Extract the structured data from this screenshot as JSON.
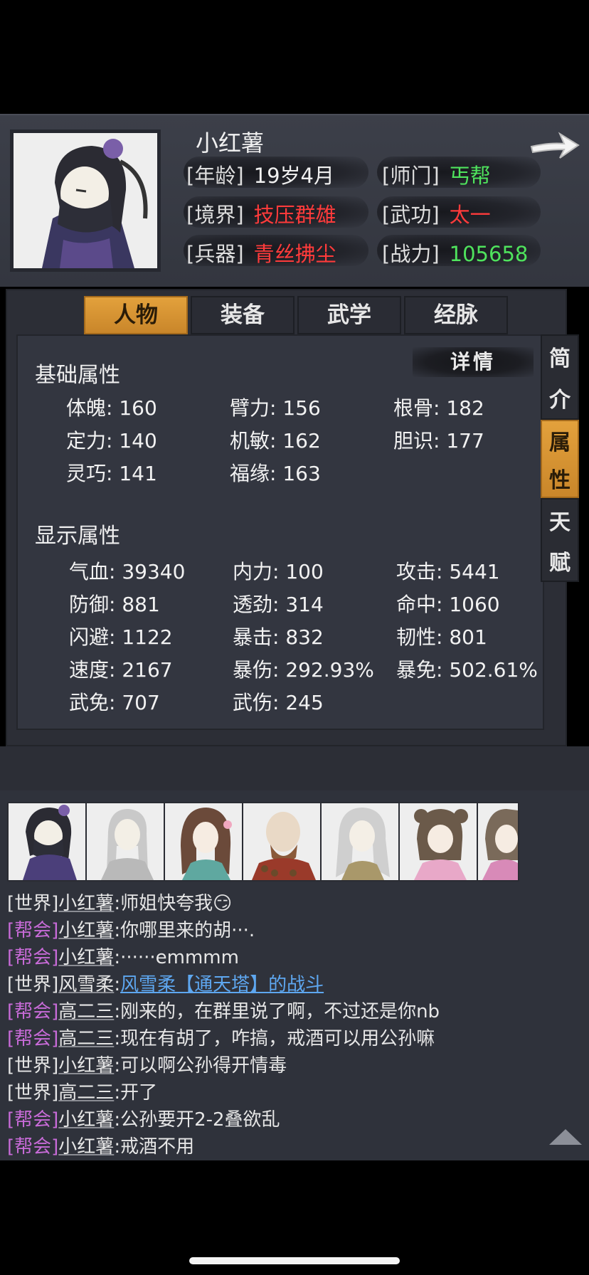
{
  "header": {
    "name": "小红薯",
    "age_label": "[年龄]",
    "age_value": "19岁4月",
    "sect_label": "[师门]",
    "sect_value": "丐帮",
    "realm_label": "[境界]",
    "realm_value": "技压群雄",
    "skill_label": "[武功]",
    "skill_value": "太一",
    "weapon_label": "[兵器]",
    "weapon_value": "青丝拂尘",
    "power_label": "[战力]",
    "power_value": "105658"
  },
  "tabs": [
    "人物",
    "装备",
    "武学",
    "经脉"
  ],
  "side_tabs": [
    {
      "c1": "简",
      "c2": "介"
    },
    {
      "c1": "属",
      "c2": "性"
    },
    {
      "c1": "天",
      "c2": "赋"
    }
  ],
  "detail_label": "详情",
  "basic_title": "基础属性",
  "basic_stats": [
    "体魄: 160",
    "臂力: 156",
    "根骨: 182",
    "定力: 140",
    "机敏: 162",
    "胆识: 177",
    "灵巧: 141",
    "福缘: 163"
  ],
  "display_title": "显示属性",
  "display_stats": [
    "气血: 39340",
    "内力: 100",
    "攻击: 5441",
    "防御: 881",
    "透劲: 314",
    "命中: 1060",
    "闪避: 1122",
    "暴击: 832",
    "韧性: 801",
    "速度: 2167",
    "暴伤: 292.93%",
    "暴免: 502.61%",
    "武免: 707",
    "武伤: 245"
  ],
  "chat": [
    {
      "ch": "[世界]",
      "who": "小红薯",
      "text": ":师姐快夸我😏"
    },
    {
      "ch": "[帮会]",
      "who": "小红薯",
      "text": ":你哪里来的胡···."
    },
    {
      "ch": "[帮会]",
      "who": "小红薯",
      "text": ":······emmmm"
    },
    {
      "ch": "[世界]",
      "who": "风雪柔",
      "text": ":",
      "link": "风雪柔【通天塔】的战斗"
    },
    {
      "ch": "[帮会]",
      "who": "高二三",
      "text": ":刚来的，在群里说了啊，不过还是你nb"
    },
    {
      "ch": "[帮会]",
      "who": "高二三",
      "text": ":现在有胡了，咋搞，戒酒可以用公孙嘛"
    },
    {
      "ch": "[世界]",
      "who": "小红薯",
      "text": ":可以啊公孙得开情毒"
    },
    {
      "ch": "[世界]",
      "who": "高二三",
      "text": ":开了"
    },
    {
      "ch": "[帮会]",
      "who": "小红薯",
      "text": ":公孙要开2-2叠欲乱"
    },
    {
      "ch": "[帮会]",
      "who": "小红薯",
      "text": ":戒酒不用"
    }
  ],
  "colors": {
    "accent": "#d9962f",
    "red_value": "#ff3b3b",
    "green_value": "#4fe35d",
    "guild_channel": "#c86bd8",
    "link": "#5ea7f0"
  }
}
